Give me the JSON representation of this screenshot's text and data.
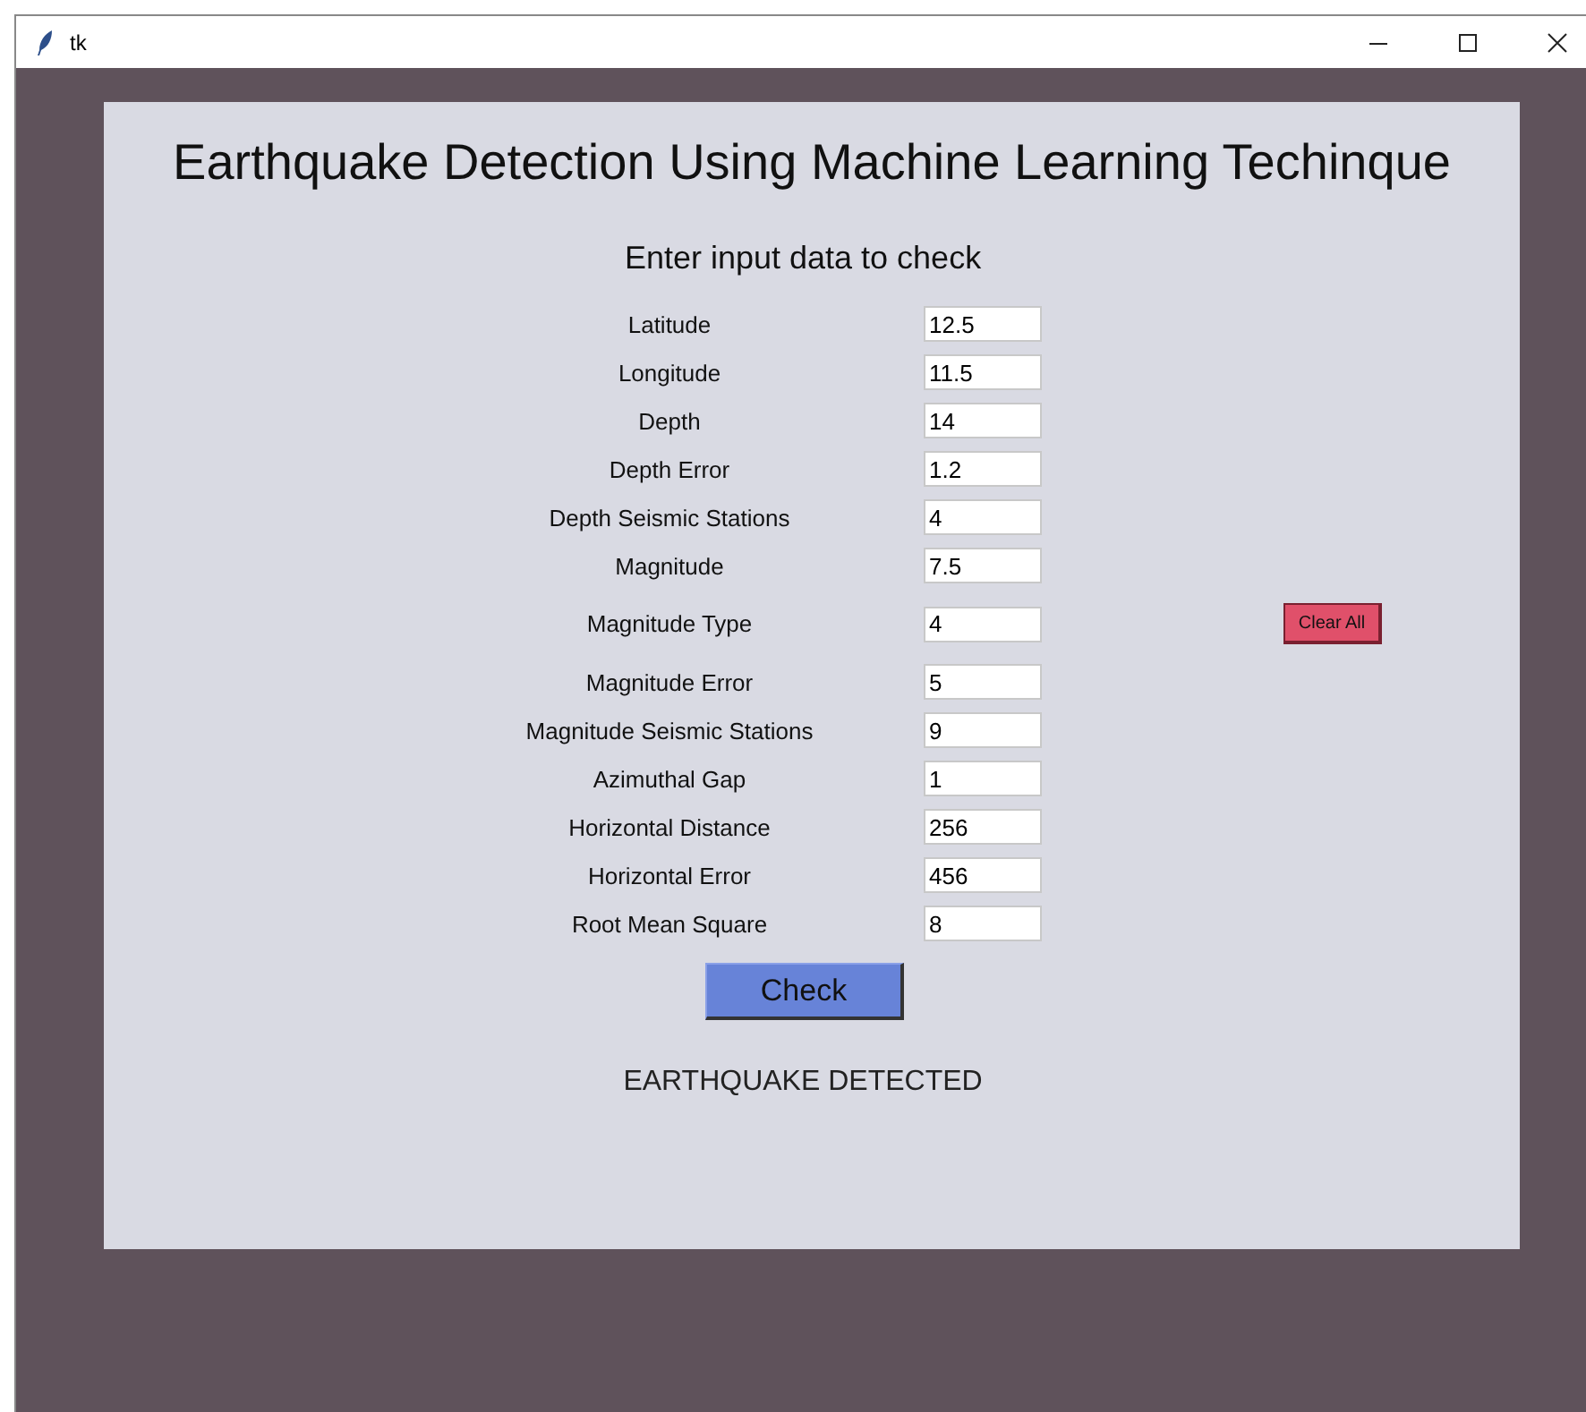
{
  "window": {
    "title": "tk"
  },
  "heading": "Earthquake Detection Using Machine Learning Techinque",
  "subheading": "Enter input data to check",
  "fields": [
    {
      "label": "Latitude",
      "value": "12.5"
    },
    {
      "label": "Longitude",
      "value": "11.5"
    },
    {
      "label": "Depth",
      "value": "14"
    },
    {
      "label": "Depth Error",
      "value": "1.2"
    },
    {
      "label": "Depth Seismic Stations",
      "value": "4"
    },
    {
      "label": "Magnitude",
      "value": "7.5"
    },
    {
      "label": "Magnitude Type",
      "value": "4"
    },
    {
      "label": "Magnitude Error",
      "value": "5"
    },
    {
      "label": "Magnitude Seismic Stations",
      "value": "9"
    },
    {
      "label": "Azimuthal Gap",
      "value": "1"
    },
    {
      "label": "Horizontal Distance",
      "value": "256"
    },
    {
      "label": "Horizontal Error",
      "value": "456"
    },
    {
      "label": "Root Mean Square",
      "value": "8"
    }
  ],
  "clear_button": "Clear All",
  "check_button": "Check",
  "result": "EARTHQUAKE DETECTED"
}
